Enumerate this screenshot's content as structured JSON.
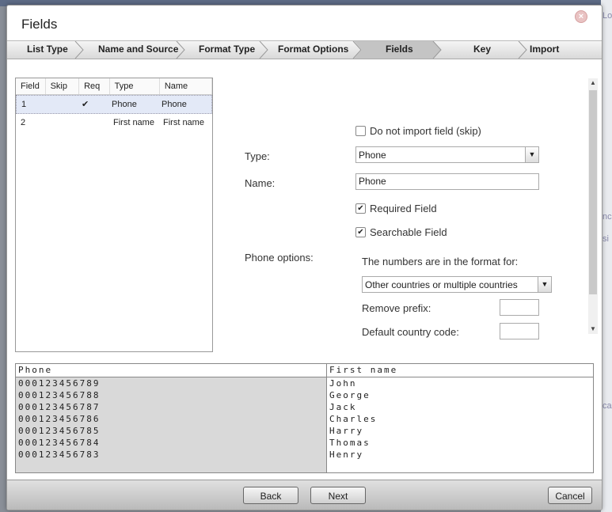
{
  "dialog": {
    "title": "Fields"
  },
  "steps": [
    "List Type",
    "Name and Source",
    "Format Type",
    "Format Options",
    "Fields",
    "Key",
    "Import Complete"
  ],
  "active_step": "Fields",
  "field_table": {
    "headers": [
      "Field",
      "Skip",
      "Req",
      "Type",
      "Name"
    ],
    "rows": [
      {
        "field": "1",
        "skip": "",
        "req": "✔",
        "type": "Phone",
        "name": "Phone"
      },
      {
        "field": "2",
        "skip": "",
        "req": "",
        "type": "First name",
        "name": "First name"
      }
    ]
  },
  "form": {
    "skip_label": "Do not import field (skip)",
    "skip_checked": false,
    "type_label": "Type:",
    "type_value": "Phone",
    "name_label": "Name:",
    "name_value": "Phone",
    "required_label": "Required Field",
    "required_checked": true,
    "searchable_label": "Searchable Field",
    "searchable_checked": true,
    "phone_options_label": "Phone options:",
    "format_for_label": "The numbers are in the format for:",
    "format_for_value": "Other countries or multiple countries",
    "remove_prefix_label": "Remove prefix:",
    "remove_prefix_value": "",
    "country_code_label": "Default country code:",
    "country_code_value": ""
  },
  "preview": {
    "headers": [
      "Phone",
      "First name"
    ],
    "phone": [
      "000123456789",
      "000123456788",
      "000123456787",
      "000123456786",
      "000123456785",
      "000123456784",
      "000123456783"
    ],
    "first_name": [
      "John",
      "George",
      "Jack",
      "Charles",
      "Harry",
      "Thomas",
      "Henry"
    ]
  },
  "buttons": {
    "back": "Back",
    "next": "Next",
    "cancel": "Cancel"
  },
  "background": {
    "right_edge_fragments": [
      "Lo",
      "nc",
      "si",
      "ca"
    ]
  },
  "checkmark": "✔",
  "icons": {
    "close": "close-icon",
    "dropdown": "chevron-down-icon"
  }
}
